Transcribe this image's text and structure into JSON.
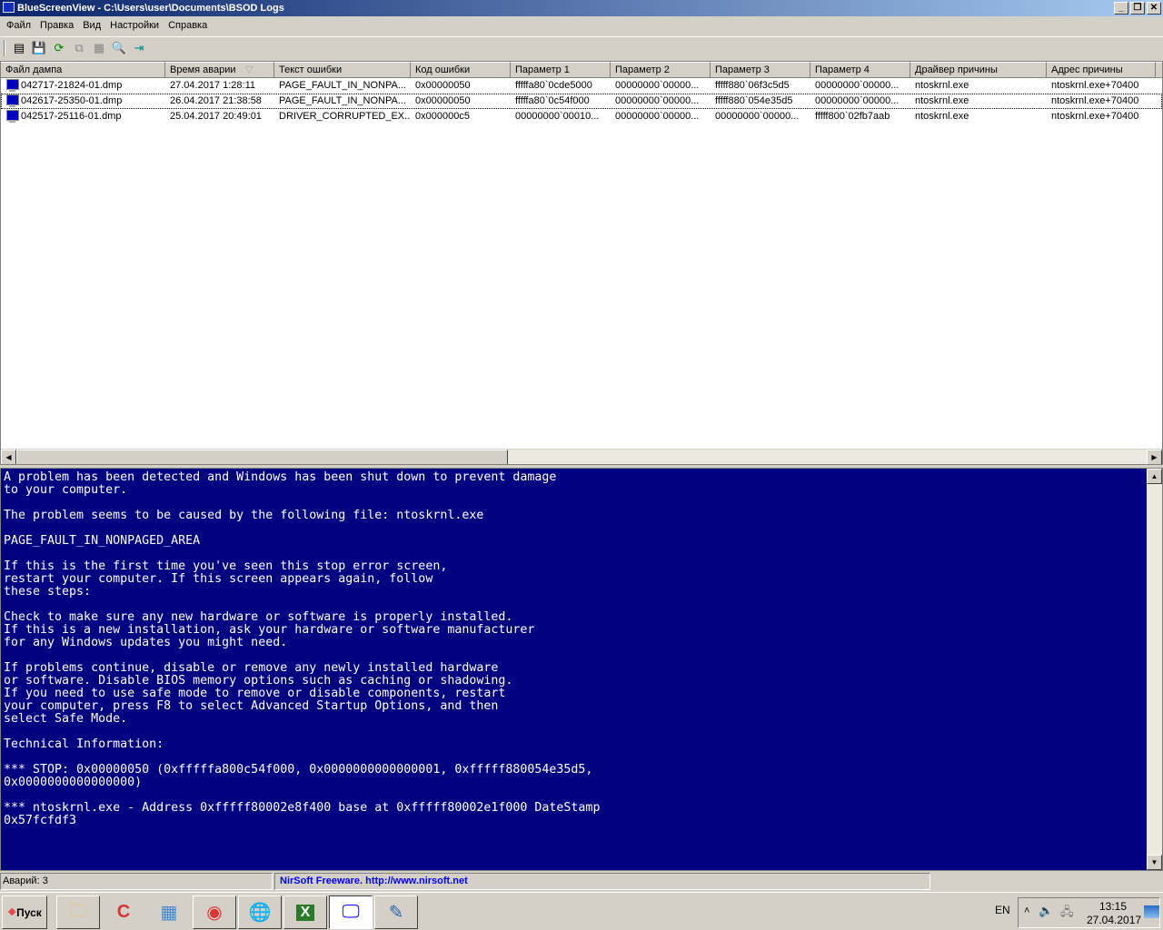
{
  "window": {
    "title": "BlueScreenView  -  C:\\Users\\user\\Documents\\BSOD Logs",
    "minimize": "_",
    "restore": "❐",
    "close": "✕"
  },
  "menu": [
    "Файл",
    "Правка",
    "Вид",
    "Настройки",
    "Справка"
  ],
  "toolbar": [
    "properties-icon",
    "save-icon",
    "refresh-icon",
    "copy-icon",
    "html-report-icon",
    "find-icon",
    "exit-icon"
  ],
  "columns": [
    "Файл дампа",
    "Время аварии",
    "Текст ошибки",
    "Код ошибки",
    "Параметр 1",
    "Параметр 2",
    "Параметр 3",
    "Параметр 4",
    "Драйвер причины",
    "Адрес причины",
    ""
  ],
  "sort_indicator": "▽",
  "rows": [
    [
      "042717-21824-01.dmp",
      "27.04.2017 1:28:11",
      "PAGE_FAULT_IN_NONPA...",
      "0x00000050",
      "fffffa80`0cde5000",
      "00000000`00000...",
      "fffff880`06f3c5d5",
      "00000000`00000...",
      "ntoskrnl.exe",
      "ntoskrnl.exe+70400"
    ],
    [
      "042617-25350-01.dmp",
      "26.04.2017 21:38:58",
      "PAGE_FAULT_IN_NONPA...",
      "0x00000050",
      "fffffa80`0c54f000",
      "00000000`00000...",
      "fffff880`054e35d5",
      "00000000`00000...",
      "ntoskrnl.exe",
      "ntoskrnl.exe+70400"
    ],
    [
      "042517-25116-01.dmp",
      "25.04.2017 20:49:01",
      "DRIVER_CORRUPTED_EX...",
      "0x000000c5",
      "00000000`00010...",
      "00000000`00000...",
      "00000000`00000...",
      "fffff800`02fb7aab",
      "ntoskrnl.exe",
      "ntoskrnl.exe+70400"
    ]
  ],
  "selected_row": 1,
  "bsod_text": "A problem has been detected and Windows has been shut down to prevent damage\nto your computer.\n\nThe problem seems to be caused by the following file: ntoskrnl.exe\n\nPAGE_FAULT_IN_NONPAGED_AREA\n\nIf this is the first time you've seen this stop error screen,\nrestart your computer. If this screen appears again, follow\nthese steps:\n\nCheck to make sure any new hardware or software is properly installed.\nIf this is a new installation, ask your hardware or software manufacturer\nfor any Windows updates you might need.\n\nIf problems continue, disable or remove any newly installed hardware\nor software. Disable BIOS memory options such as caching or shadowing.\nIf you need to use safe mode to remove or disable components, restart\nyour computer, press F8 to select Advanced Startup Options, and then\nselect Safe Mode.\n\nTechnical Information:\n\n*** STOP: 0x00000050 (0xfffffa800c54f000, 0x0000000000000001, 0xfffff880054e35d5,\n0x0000000000000000)\n\n*** ntoskrnl.exe - Address 0xfffff80002e8f400 base at 0xfffff80002e1f000 DateStamp\n0x57fcfdf3",
  "status": {
    "count": "Аварий: 3",
    "link": "NirSoft Freeware.  http://www.nirsoft.net"
  },
  "taskbar": {
    "start": "Пуск",
    "lang": "EN",
    "time": "13:15",
    "date": "27.04.2017"
  },
  "colors": {
    "bsod_bg": "#000080",
    "link": "#0000ff"
  }
}
